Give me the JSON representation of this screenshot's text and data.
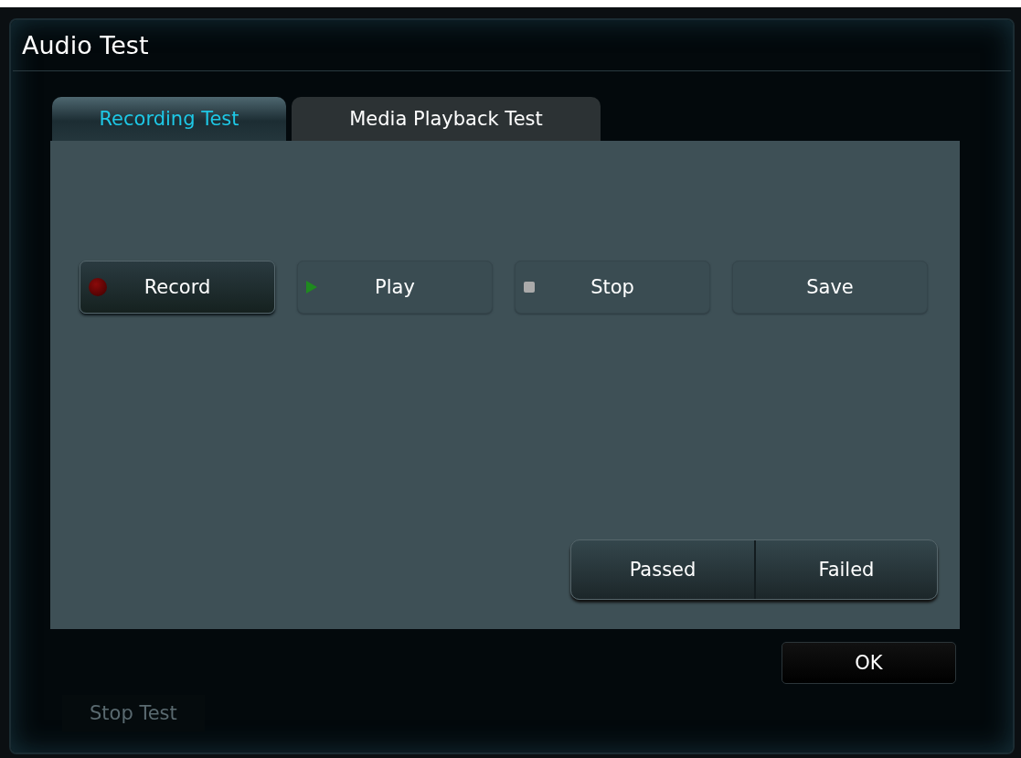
{
  "window": {
    "title": "Audio Test"
  },
  "tabs": [
    {
      "label": "Recording Test",
      "selected": true
    },
    {
      "label": "Media Playback Test",
      "selected": false
    }
  ],
  "controls": [
    {
      "label": "Record",
      "kind": "record",
      "active": true
    },
    {
      "label": "Play",
      "kind": "play",
      "active": false
    },
    {
      "label": "Stop",
      "kind": "stop",
      "active": false
    },
    {
      "label": "Save",
      "kind": "plain",
      "active": false
    }
  ],
  "verdict": [
    "Passed",
    "Failed"
  ],
  "background_button": "Stop Test",
  "buttons": [
    "OK"
  ]
}
